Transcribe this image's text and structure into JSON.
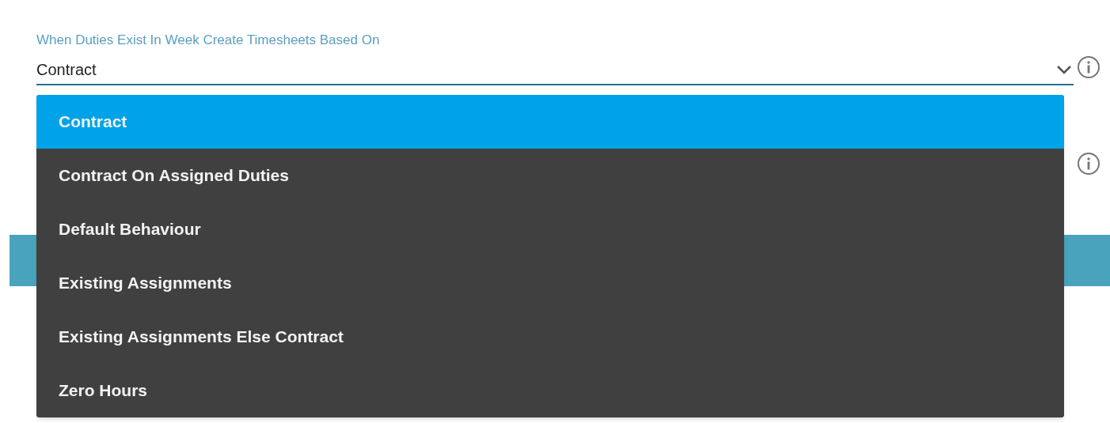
{
  "field": {
    "label": "When Duties Exist In Week Create Timesheets Based On",
    "value": "Contract",
    "expanded": true
  },
  "options": [
    {
      "label": "Contract",
      "selected": true
    },
    {
      "label": "Contract On Assigned Duties",
      "selected": false
    },
    {
      "label": "Default Behaviour",
      "selected": false
    },
    {
      "label": "Existing Assignments",
      "selected": false
    },
    {
      "label": "Existing Assignments Else Contract",
      "selected": false
    },
    {
      "label": "Zero Hours",
      "selected": false
    }
  ]
}
